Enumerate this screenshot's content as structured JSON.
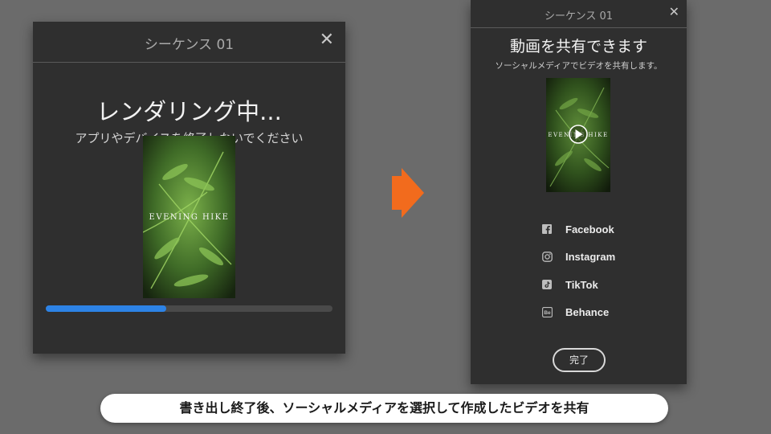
{
  "render_dialog": {
    "title": "シーケンス 01",
    "heading": "レンダリング中...",
    "subtitle": "アプリやデバイスを終了しないでください",
    "thumbnail_text": "EVENING HIKE",
    "progress": 0.42,
    "close_icon": "close-icon"
  },
  "share_dialog": {
    "title": "シーケンス 01",
    "heading": "動画を共有できます",
    "subtitle": "ソーシャルメディアでビデオを共有します。",
    "thumbnail_text": "EVENING HIKE",
    "items": [
      {
        "label": "Facebook",
        "icon": "facebook-icon"
      },
      {
        "label": "Instagram",
        "icon": "instagram-icon"
      },
      {
        "label": "TikTok",
        "icon": "tiktok-icon"
      },
      {
        "label": "Behance",
        "icon": "behance-icon"
      }
    ],
    "done_label": "完了",
    "close_icon": "close-icon"
  },
  "arrow_color": "#f26b1d",
  "progress_color": "#2d83e6",
  "caption": "書き出し終了後、ソーシャルメディアを選択して作成したビデオを共有"
}
